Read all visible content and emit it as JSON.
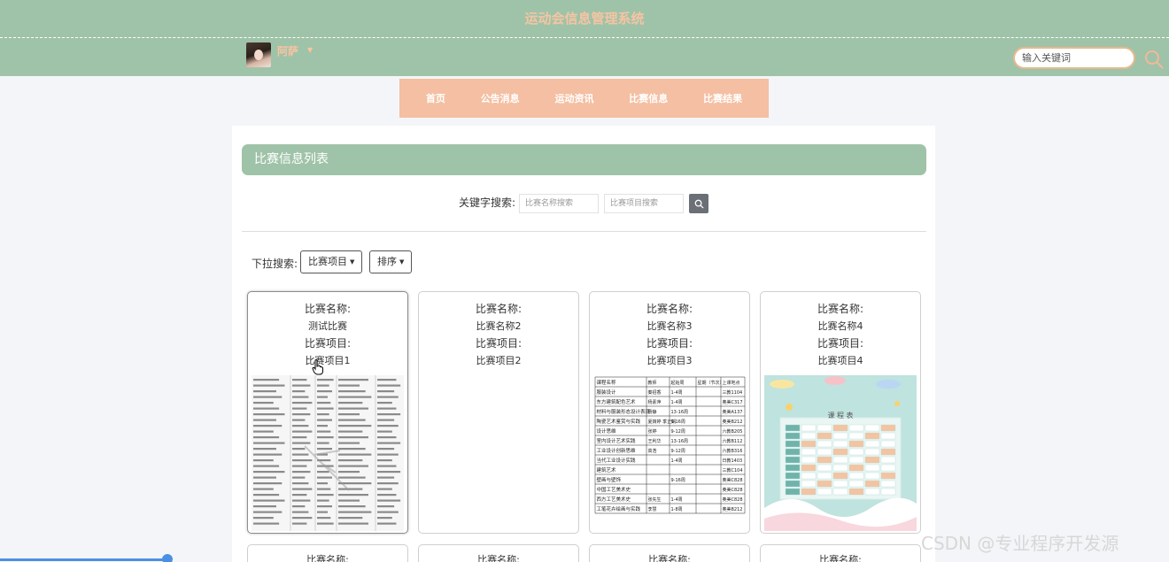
{
  "header": {
    "site_title": "运动会信息管理系统",
    "username": "阿萨",
    "search_placeholder": "输入关键词"
  },
  "nav": [
    "首页",
    "公告消息",
    "运动资讯",
    "比赛信息",
    "比赛结果"
  ],
  "list": {
    "title": "比赛信息列表",
    "keyword_label": "关键字搜索:",
    "name_placeholder": "比赛名称搜索",
    "project_placeholder": "比赛项目搜索",
    "dropdown_label": "下拉搜索:",
    "dropdown_project": "比赛项目",
    "dropdown_sort": "排序"
  },
  "cards": [
    {
      "name_label": "比赛名称:",
      "name": "测试比赛",
      "project_label": "比赛项目:",
      "project": "比赛项目1"
    },
    {
      "name_label": "比赛名称:",
      "name": "比赛名称2",
      "project_label": "比赛项目:",
      "project": "比赛项目2"
    },
    {
      "name_label": "比赛名称:",
      "name": "比赛名称3",
      "project_label": "比赛项目:",
      "project": "比赛项目3"
    },
    {
      "name_label": "比赛名称:",
      "name": "比赛名称4",
      "project_label": "比赛项目:",
      "project": "比赛项目4"
    }
  ],
  "next_row_label": "比赛名称:",
  "schedule_image": {
    "headers": [
      "课程名称",
      "教师",
      "起始周",
      "星期（节次）",
      "上课地点"
    ],
    "rows": [
      [
        "服装设计",
        "秦招香",
        "1-4周",
        "",
        "三教1104"
      ],
      [
        "东方建筑配色艺术",
        "杨素萍",
        "1-4周",
        "",
        "奥美C317"
      ],
      [
        "材料与服装形态设计表现",
        "杨静",
        "13-16周",
        "",
        "奥美A137"
      ],
      [
        "陶瓷艺术鉴赏与实践",
        "夏婧婷 季正娟",
        "9-16周",
        "",
        "奥美B212"
      ],
      [
        "设计思维",
        "张婷",
        "9-12周",
        "",
        "六教B205"
      ],
      [
        "室内设计艺术实践",
        "王利华",
        "13-16周",
        "",
        "六教B112"
      ],
      [
        "工业设计创新思维",
        "高浩",
        "9-12周",
        "",
        "六教B316"
      ],
      [
        "当代工业设计实践",
        "",
        "1-4周",
        "",
        "日教1403"
      ],
      [
        "建筑艺术",
        "",
        "",
        "",
        "三教C104"
      ],
      [
        "壁画与壁饰",
        "",
        "9-16周",
        "",
        "奥美C828"
      ],
      [
        "中国工艺美术史",
        "",
        "",
        "",
        "奥美C828"
      ],
      [
        "西方工艺美术史",
        "张先生",
        "1-4周",
        "",
        "奥美C828"
      ],
      [
        "工笔花卉绘画与实践",
        "李慧",
        "1-8周",
        "",
        "奥美B212"
      ]
    ]
  },
  "decorative_title": "课 程 表",
  "watermark": "CSDN @专业程序开发源"
}
